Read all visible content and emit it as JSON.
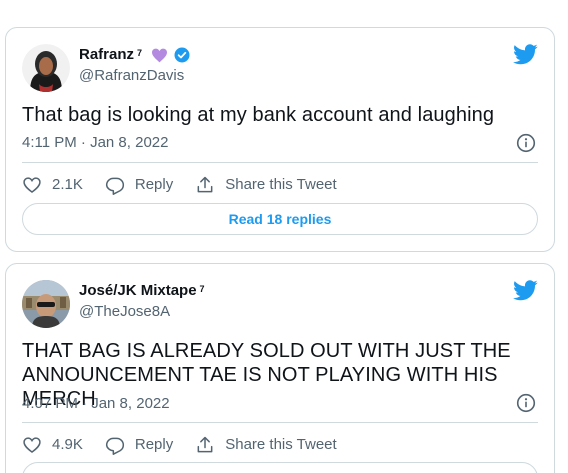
{
  "colors": {
    "accent": "#1d9bf0",
    "text": "#0f1419",
    "muted": "#536471",
    "border": "#cfd9de",
    "heart_emoji": "#b38ae0"
  },
  "tweets": [
    {
      "name": "Rafranz",
      "name_sup": "7",
      "handle": "@RafranzDavis",
      "has_verified": true,
      "has_heart": true,
      "text": "That bag is looking at my bank account and laughing",
      "time": "4:11 PM · Jan 8, 2022",
      "likes": "2.1K",
      "reply_label": "Reply",
      "share_label": "Share this Tweet",
      "read_replies": "Read 18 replies",
      "icons": [
        "twitter-bird-icon",
        "info-icon",
        "heart-icon",
        "reply-icon",
        "share-icon",
        "verified-badge-icon"
      ]
    },
    {
      "name": "José/JK Mixtape",
      "name_sup": "7",
      "handle": "@TheJose8A",
      "has_verified": false,
      "has_heart": false,
      "text_line1": "THAT BAG IS ALREADY SOLD OUT WITH JUST THE",
      "text_line2": "ANNOUNCEMENT TAE IS NOT PLAYING WITH HIS MERCH",
      "time": "4:07 PM · Jan 8, 2022",
      "likes": "4.9K",
      "reply_label": "Reply",
      "share_label": "Share this Tweet",
      "icons": [
        "twitter-bird-icon",
        "info-icon",
        "heart-icon",
        "reply-icon",
        "share-icon"
      ]
    }
  ]
}
